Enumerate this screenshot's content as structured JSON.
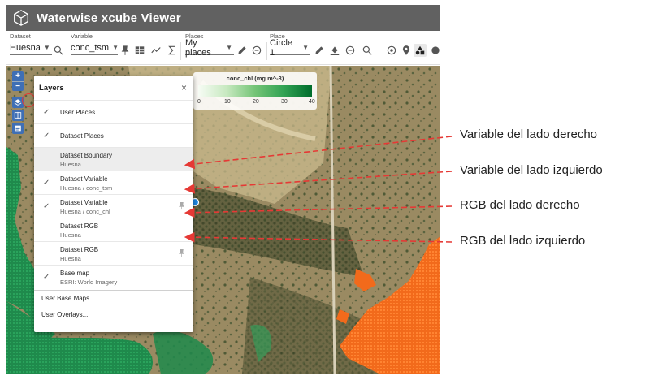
{
  "app": {
    "title": "Waterwise xcube Viewer"
  },
  "toolbar": {
    "dataset": {
      "label": "Dataset",
      "value": "Huesna"
    },
    "variable": {
      "label": "Variable",
      "value": "conc_tsm"
    },
    "places": {
      "label": "Places",
      "value": "My places"
    },
    "place": {
      "label": "Place",
      "value": "Circle 1"
    }
  },
  "map_controls": {
    "zoom_in": "+",
    "zoom_out": "−"
  },
  "legend": {
    "title": "conc_chl (mg m^-3)",
    "ticks": [
      "0",
      "10",
      "20",
      "30",
      "40"
    ],
    "colors": [
      "#f7fcf5",
      "#c7e9c0",
      "#74c476",
      "#31a354",
      "#006d2c"
    ]
  },
  "layers_panel": {
    "title": "Layers",
    "close": "×",
    "items": [
      {
        "label": "User Places",
        "checked": "✓"
      },
      {
        "label": "Dataset Places",
        "checked": "✓"
      },
      {
        "label": "Dataset Boundary",
        "sub": "Huesna"
      },
      {
        "label": "Dataset Variable",
        "sub": "Huesna / conc_tsm",
        "checked": "✓"
      },
      {
        "label": "Dataset Variable",
        "sub": "Huesna / conc_chl",
        "checked": "✓",
        "pinned": true
      },
      {
        "label": "Dataset RGB",
        "sub": "Huesna"
      },
      {
        "label": "Dataset RGB",
        "sub": "Huesna",
        "pinned": true
      },
      {
        "label": "Base map",
        "sub": "ESRI: World Imagery",
        "checked": "✓"
      }
    ],
    "footer": [
      "User Base Maps...",
      "User Overlays..."
    ]
  },
  "annotations": [
    "Variable del lado derecho",
    "Variable del lado izquierdo",
    "RGB del lado derecho",
    "RGB del lado izquierdo"
  ],
  "colors": {
    "appbar": "#616161",
    "annotation_arrow": "#e53935",
    "map_control": "#3f6fb5",
    "left_overlay_green": "#1f8a4c",
    "right_overlay_orange": "#f26a1b"
  }
}
